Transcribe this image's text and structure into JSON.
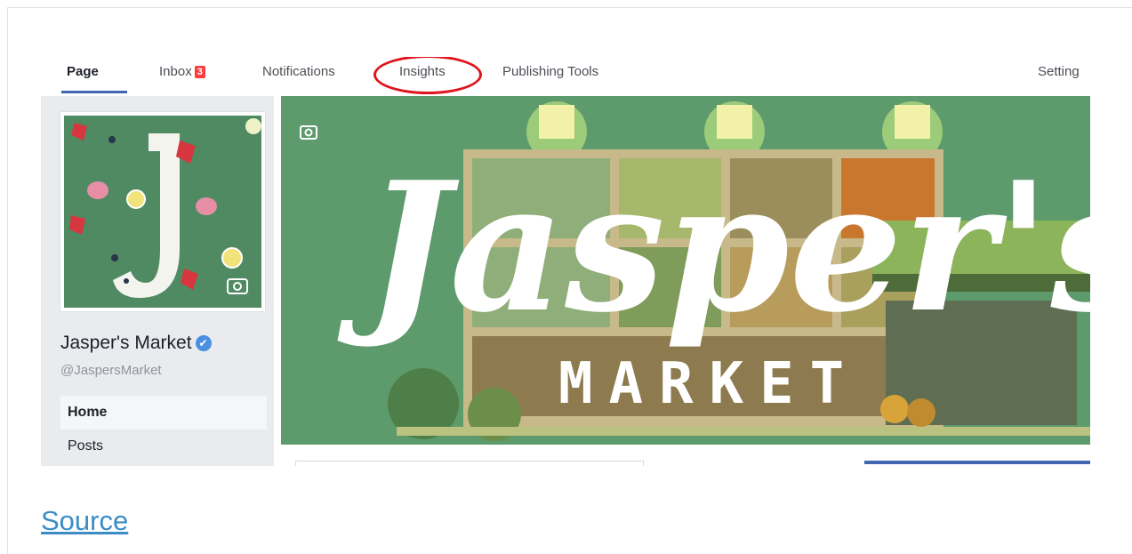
{
  "tabs": {
    "page": "Page",
    "inbox": "Inbox",
    "inbox_count": "3",
    "notifications": "Notifications",
    "insights": "Insights",
    "publishing_tools": "Publishing Tools",
    "settings": "Setting"
  },
  "profile": {
    "name": "Jasper's Market",
    "handle": "@JaspersMarket",
    "verified_icon": "checkmark-icon"
  },
  "nav": {
    "home": "Home",
    "posts": "Posts"
  },
  "cover": {
    "title": "Jasper's",
    "subtitle": "MARKET"
  },
  "source_link": "Source",
  "colors": {
    "accent": "#4267b2",
    "badge": "#fa3e3e",
    "highlight_ring": "#e0141c",
    "cover_green": "#5d9a6c",
    "link": "#3a8dc5"
  }
}
